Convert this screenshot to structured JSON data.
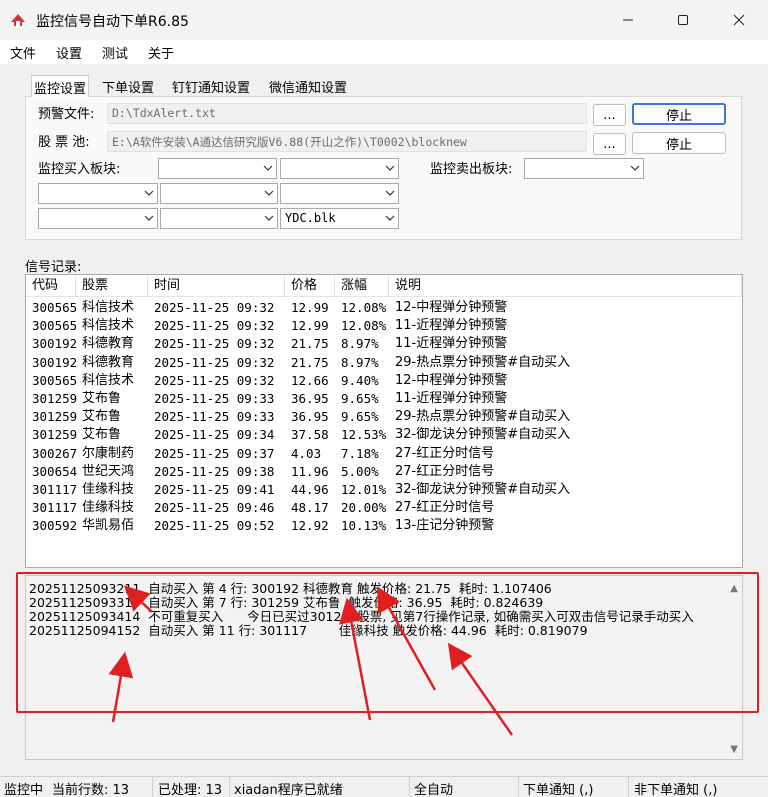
{
  "window": {
    "title": "监控信号自动下单R6.85"
  },
  "menu": [
    "文件",
    "设置",
    "测试",
    "关于"
  ],
  "tabs": [
    "监控设置",
    "下单设置",
    "钉钉通知设置",
    "微信通知设置"
  ],
  "settings": {
    "alert_file_label": "预警文件:",
    "alert_file_path": "D:\\TdxAlert.txt",
    "stock_pool_label": "股 票 池:",
    "stock_pool_path": "E:\\A软件安装\\A通达信研究版V6.88(开山之作)\\T0002\\blocknew",
    "browse_label": "...",
    "stop_label": "停止",
    "buy_block_label": "监控买入板块:",
    "sell_block_label": "监控卖出板块:",
    "combo_value": "YDC.blk"
  },
  "records": {
    "label": "信号记录:",
    "columns": [
      "代码",
      "股票",
      "时间",
      "价格",
      "涨幅",
      "说明"
    ],
    "rows": [
      [
        "300565",
        "科信技术",
        "2025-11-25 09:32",
        "12.99",
        "12.08%",
        "12-中程弹分钟预警"
      ],
      [
        "300565",
        "科信技术",
        "2025-11-25 09:32",
        "12.99",
        "12.08%",
        "11-近程弹分钟预警"
      ],
      [
        "300192",
        "科德教育",
        "2025-11-25 09:32",
        "21.75",
        "8.97%",
        "11-近程弹分钟预警"
      ],
      [
        "300192",
        "科德教育",
        "2025-11-25 09:32",
        "21.75",
        "8.97%",
        "29-热点票分钟预警#自动买入"
      ],
      [
        "300565",
        "科信技术",
        "2025-11-25 09:32",
        "12.66",
        "9.40%",
        "12-中程弹分钟预警"
      ],
      [
        "301259",
        "艾布鲁",
        "2025-11-25 09:33",
        "36.95",
        "9.65%",
        "11-近程弹分钟预警"
      ],
      [
        "301259",
        "艾布鲁",
        "2025-11-25 09:33",
        "36.95",
        "9.65%",
        "29-热点票分钟预警#自动买入"
      ],
      [
        "301259",
        "艾布鲁",
        "2025-11-25 09:34",
        "37.58",
        "12.53%",
        "32-御龙诀分钟预警#自动买入"
      ],
      [
        "300267",
        "尔康制药",
        "2025-11-25 09:37",
        "4.03",
        "7.18%",
        "27-红正分时信号"
      ],
      [
        "300654",
        "世纪天鸿",
        "2025-11-25 09:38",
        "11.96",
        "5.00%",
        "27-红正分时信号"
      ],
      [
        "301117",
        "佳缘科技",
        "2025-11-25 09:41",
        "44.96",
        "12.01%",
        "32-御龙诀分钟预警#自动买入"
      ],
      [
        "301117",
        "佳缘科技",
        "2025-11-25 09:46",
        "48.17",
        "20.00%",
        "27-红正分时信号"
      ],
      [
        "300592",
        "华凯易佰",
        "2025-11-25 09:52",
        "12.92",
        "10.13%",
        "13-庄记分钟预警"
      ]
    ]
  },
  "log": "20251125093211  自动买入 第 4 行: 300192 科德教育 触发价格: 21.75  耗时: 1.107406\n20251125093317  自动买入 第 7 行: 301259 艾布鲁  触发价格: 36.95  耗时: 0.824639\n20251125093414  不可重复买入      今日已买过301259股票, 见第7行操作记录, 如确需买入可双击信号记录手动买入\n20251125094152  自动买入 第 11 行: 301117        佳缘科技 触发价格: 44.96  耗时: 0.819079",
  "status": {
    "monitoring": "监控中",
    "current_rows": "当前行数: 13",
    "processed": "已处理: 13",
    "xiadan": "xiadan程序已就绪",
    "mode": "全自动",
    "order_notify": "下单通知 (,)",
    "non_order_notify": "非下单通知 (,)"
  },
  "colors": {
    "annotation": "#e02020",
    "focus": "#3a78d6"
  }
}
